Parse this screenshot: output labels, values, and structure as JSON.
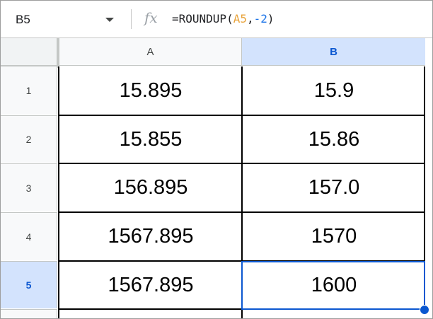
{
  "formula_bar": {
    "name_box": "B5",
    "formula": {
      "prefix": "=ROUNDUP(",
      "ref": "A5",
      "sep": ",",
      "arg": "-2",
      "suffix": ")"
    },
    "fx_label": "fx"
  },
  "columns": [
    {
      "label": "A"
    },
    {
      "label": "B"
    }
  ],
  "rows": [
    {
      "num": "1",
      "a": "15.895",
      "b": "15.9"
    },
    {
      "num": "2",
      "a": "15.855",
      "b": "15.86"
    },
    {
      "num": "3",
      "a": "156.895",
      "b": "157.0"
    },
    {
      "num": "4",
      "a": "1567.895",
      "b": "1570"
    },
    {
      "num": "5",
      "a": "1567.895",
      "b": "1600"
    }
  ],
  "selection": {
    "cell": "B5"
  },
  "colors": {
    "selection": "#0b57d0",
    "selected_header_bg": "#d3e3fd",
    "formula_ref": "#e8a33b",
    "formula_number": "#1a73e8"
  }
}
